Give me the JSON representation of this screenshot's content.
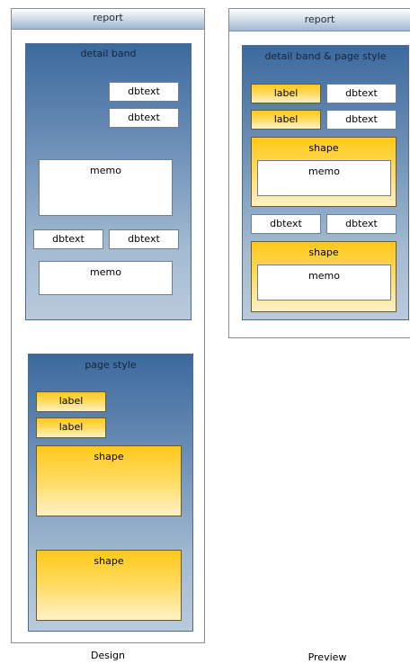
{
  "design": {
    "report_title": "report",
    "detail_band": {
      "title": "detail band",
      "dbtext": [
        "dbtext",
        "dbtext",
        "dbtext",
        "dbtext"
      ],
      "memo": [
        "memo",
        "memo"
      ]
    },
    "page_style": {
      "title": "page style",
      "labels": [
        "label",
        "label"
      ],
      "shapes": [
        "shape",
        "shape"
      ]
    },
    "caption": "Design"
  },
  "preview": {
    "report_title": "report",
    "band": {
      "title": "detail band & page style",
      "labels": [
        "label",
        "label"
      ],
      "dbtext": [
        "dbtext",
        "dbtext",
        "dbtext",
        "dbtext"
      ],
      "shapes": [
        "shape",
        "shape"
      ],
      "memo": [
        "memo",
        "memo"
      ]
    },
    "caption": "Preview"
  },
  "colors": {
    "band_top": "#3c6a9e",
    "band_bottom": "#b9cadc",
    "gold_top": "#ffc91a",
    "gold_bottom": "#fff1c8"
  }
}
